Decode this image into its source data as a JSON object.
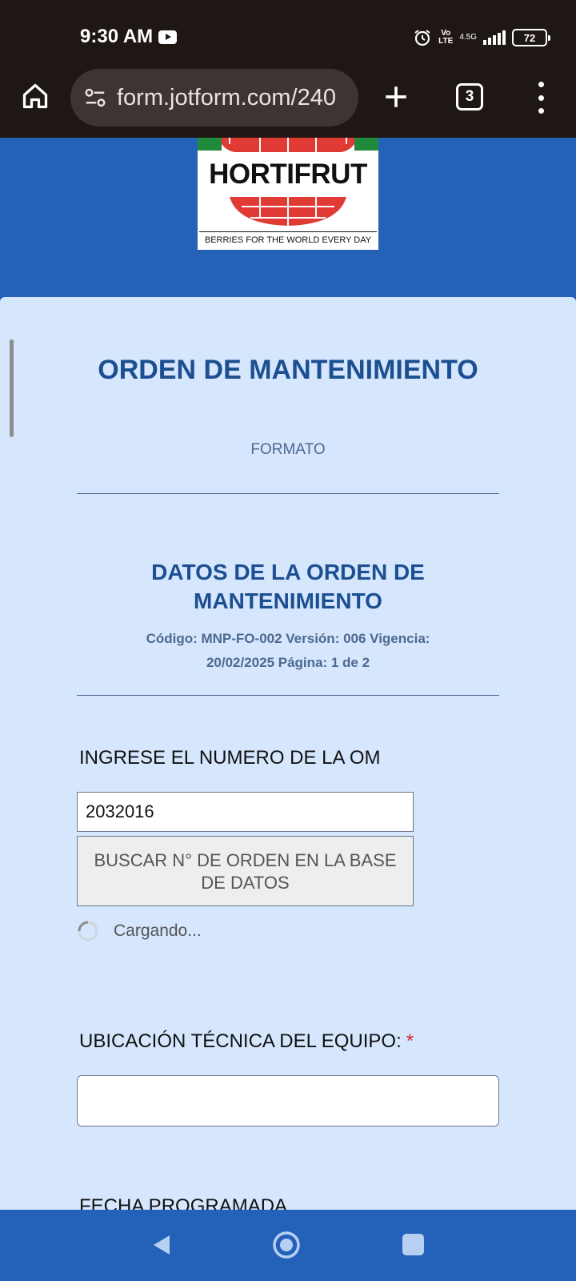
{
  "status_bar": {
    "time": "9:30 AM",
    "volte": "Vo\nLTE",
    "network": "4.5G",
    "battery": "72",
    "icons": [
      "youtube-icon",
      "alarm-icon",
      "signal-icon",
      "battery-icon"
    ]
  },
  "browser": {
    "url": "form.jotform.com/240",
    "tab_count": "3",
    "icons": [
      "home-icon",
      "site-settings-icon",
      "new-tab-icon",
      "tabs-icon",
      "more-menu-icon"
    ]
  },
  "logo": {
    "name": "HORTIFRUT",
    "tagline": "BERRIES FOR THE WORLD EVERY DAY"
  },
  "form": {
    "title": "ORDEN DE MANTENIMIENTO",
    "subtitle": "FORMATO",
    "section_title": "DATOS DE LA ORDEN DE MANTENIMIENTO",
    "section_description": "Código: MNP-FO-002 Versión: 006 Vigencia: 20/02/2025 Página: 1 de 2",
    "om_label": "INGRESE EL NUMERO DE LA OM",
    "om_value": "2032016",
    "search_button": "BUSCAR N° DE ORDEN EN LA BASE DE DATOS",
    "loading_text": "Cargando...",
    "location_label": "UBICACIÓN TÉCNICA DEL EQUIPO:",
    "required_marker": "*",
    "location_value": "",
    "next_label": "FECHA PROGRAMADA"
  },
  "colors": {
    "page_bg": "#2462b9",
    "card_bg": "#d5e6fd",
    "heading": "#1c4f91",
    "required": "#d62a2a",
    "system_bar": "#1e1713"
  }
}
